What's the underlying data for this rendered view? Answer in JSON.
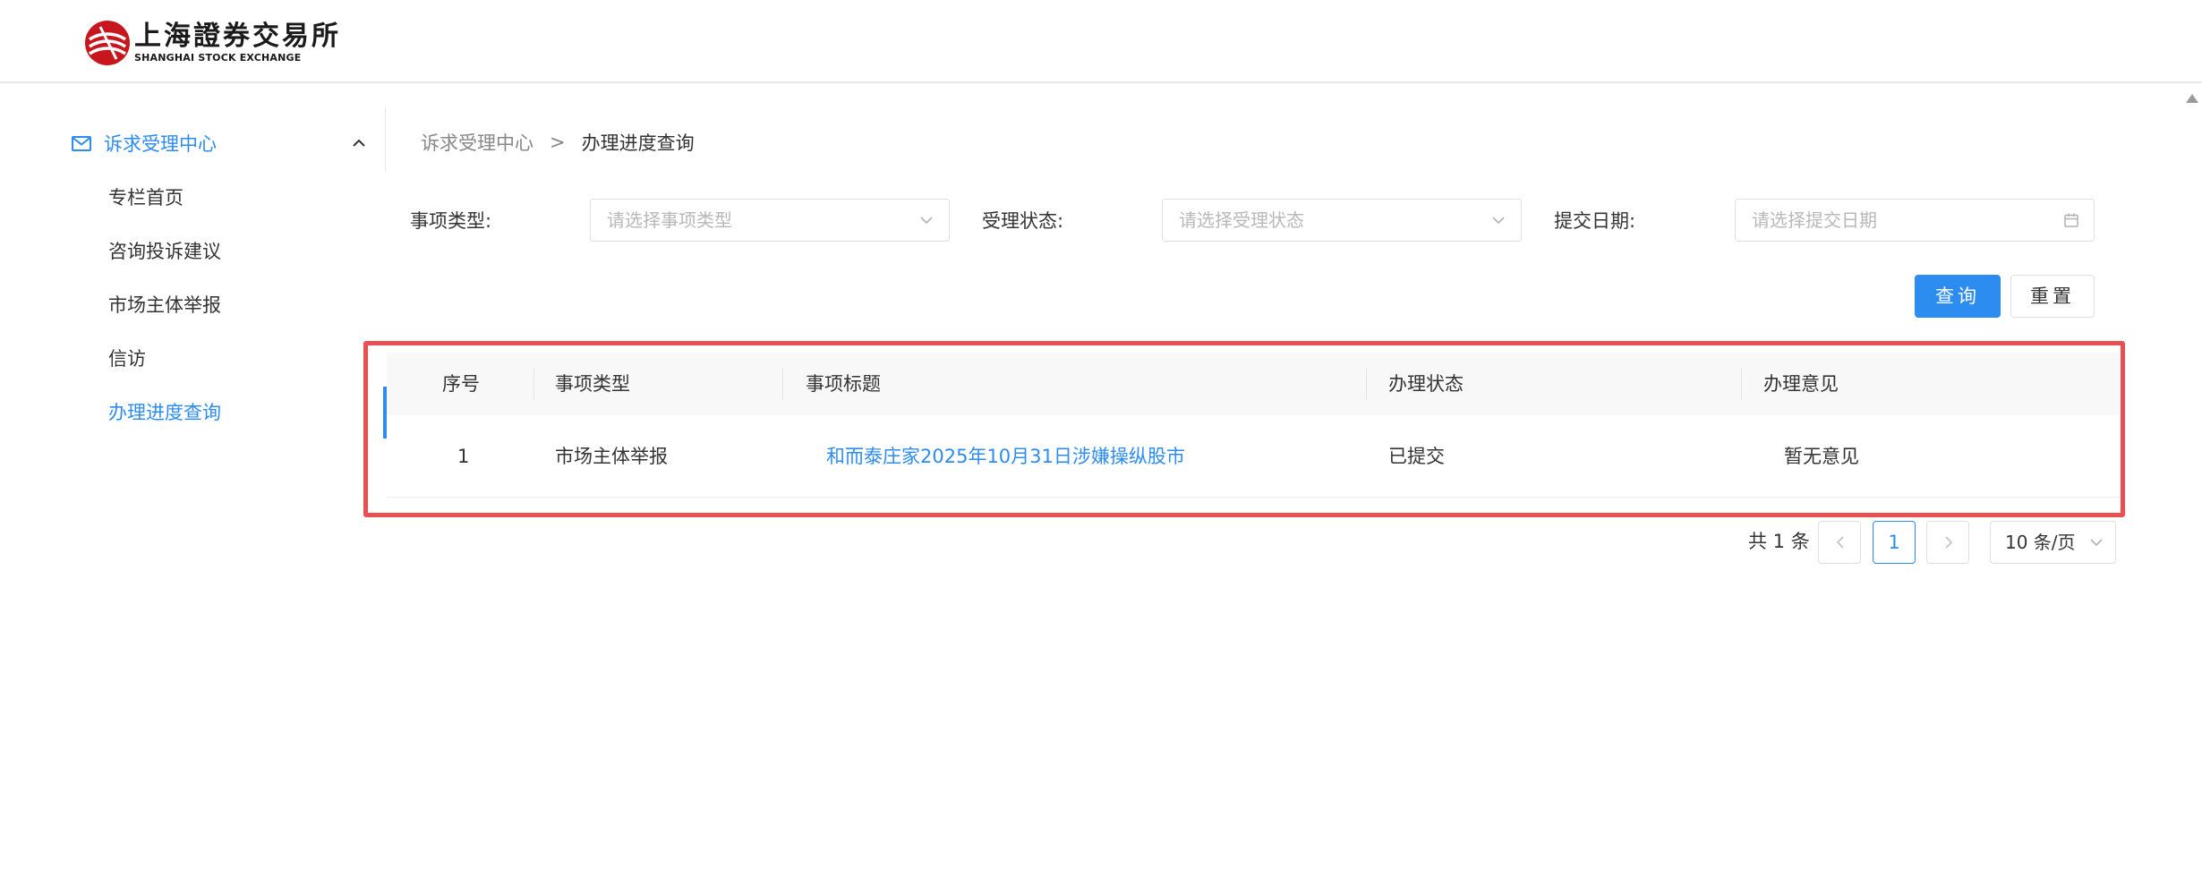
{
  "header": {
    "logo_cn": "上海證券交易所",
    "logo_en": "SHANGHAI STOCK EXCHANGE"
  },
  "sidebar": {
    "group": {
      "label": "诉求受理中心",
      "icon": "mail-icon",
      "expanded": true
    },
    "items": [
      {
        "label": "专栏首页",
        "active": false
      },
      {
        "label": "咨询投诉建议",
        "active": false
      },
      {
        "label": "市场主体举报",
        "active": false
      },
      {
        "label": "信访",
        "active": false
      },
      {
        "label": "办理进度查询",
        "active": true
      }
    ]
  },
  "breadcrumb": {
    "parent": "诉求受理中心",
    "separator": ">",
    "current": "办理进度查询"
  },
  "filters": [
    {
      "label": "事项类型:",
      "placeholder": "请选择事项类型",
      "icon": "chevron-down-icon"
    },
    {
      "label": "受理状态:",
      "placeholder": "请选择受理状态",
      "icon": "chevron-down-icon"
    },
    {
      "label": "提交日期:",
      "placeholder": "请选择提交日期",
      "icon": "calendar-icon"
    }
  ],
  "buttons": {
    "search": "查询",
    "reset": "重置"
  },
  "table": {
    "columns": [
      "序号",
      "事项类型",
      "事项标题",
      "办理状态",
      "办理意见"
    ],
    "rows": [
      {
        "index": "1",
        "type": "市场主体举报",
        "title": "和而泰庄家2025年10月31日涉嫌操纵股市",
        "status": "已提交",
        "opinion": "暂无意见"
      }
    ]
  },
  "pagination": {
    "total": "共 1 条",
    "current_page": "1",
    "page_size": "10 条/页"
  },
  "colors": {
    "accent": "#2d8cf0",
    "highlight_frame": "#e9504f",
    "logo_red": "#c8161e"
  }
}
